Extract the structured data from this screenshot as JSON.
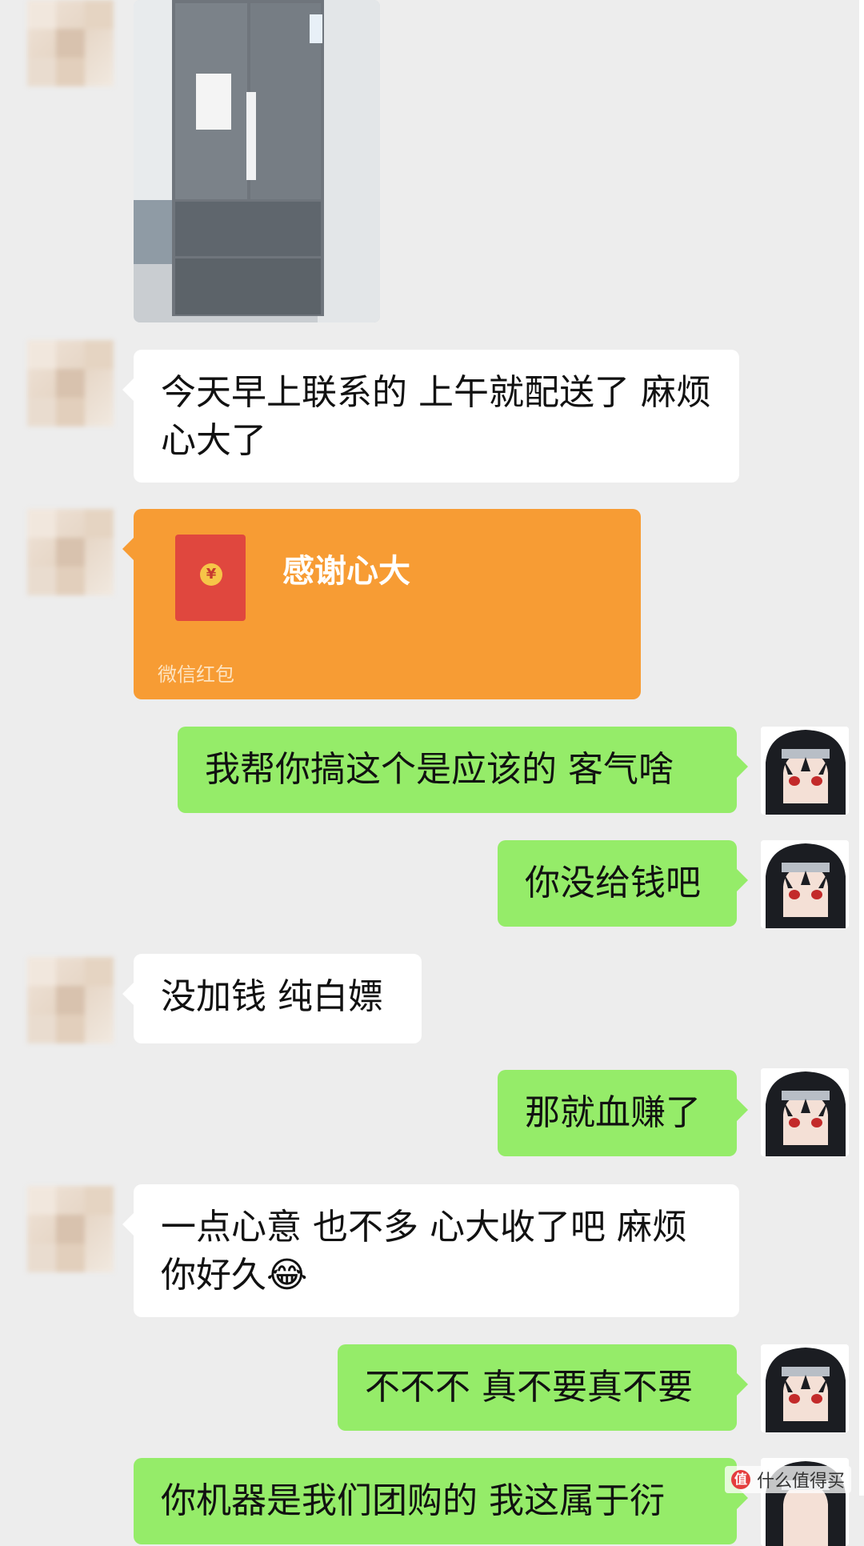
{
  "chat": {
    "messages": [
      {
        "side": "left",
        "type": "image",
        "content": "refrigerator-photo"
      },
      {
        "side": "left",
        "type": "text",
        "text": "今天早上联系的 上午就配送了 麻烦心大了"
      },
      {
        "side": "left",
        "type": "red_packet",
        "title": "感谢心大",
        "label": "微信红包"
      },
      {
        "side": "right",
        "type": "text",
        "text": "我帮你搞这个是应该的 客气啥"
      },
      {
        "side": "right",
        "type": "text",
        "text": "你没给钱吧"
      },
      {
        "side": "left",
        "type": "text",
        "text": "没加钱 纯白嫖"
      },
      {
        "side": "right",
        "type": "text",
        "text": "那就血赚了"
      },
      {
        "side": "left",
        "type": "text",
        "text": "一点心意 也不多 心大收了吧 麻烦你好久😂"
      },
      {
        "side": "right",
        "type": "text",
        "text": "不不不 真不要真不要"
      },
      {
        "side": "left",
        "type": "text",
        "text": "你机器是我们团购的 我这属于衍"
      }
    ]
  },
  "colors": {
    "page": "#ededed",
    "incoming": "#ffffff",
    "outgoing": "#95ec69",
    "red_packet": "#f79c34"
  },
  "watermark": {
    "text": "什么值得买"
  }
}
